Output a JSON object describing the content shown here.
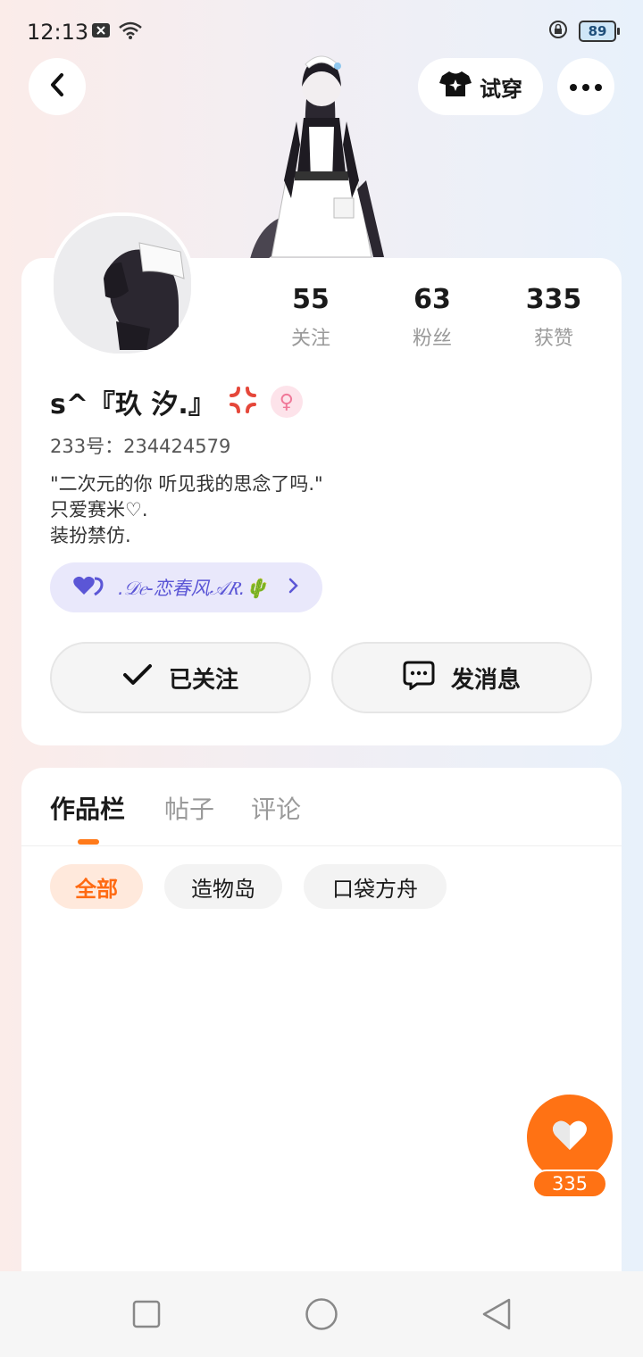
{
  "status_bar": {
    "time": "12:13",
    "battery": "89"
  },
  "header": {
    "tryon_label": "试穿"
  },
  "profile": {
    "stats": [
      {
        "value": "55",
        "label": "关注"
      },
      {
        "value": "63",
        "label": "粉丝"
      },
      {
        "value": "335",
        "label": "获赞"
      }
    ],
    "username": "s^『玖 汐.』",
    "user_id": "233号：234424579",
    "bio_lines": [
      "\"二次元的你 听见我的思念了吗.\"",
      "只爱赛米♡.",
      "装扮禁仿."
    ],
    "group_name": ".𝒟𝑒-恋春风𝒜𝑅.🌵",
    "follow_label": "已关注",
    "message_label": "发消息"
  },
  "tabs": [
    "作品栏",
    "帖子",
    "评论"
  ],
  "chips": [
    "全部",
    "造物岛",
    "口袋方舟"
  ],
  "like_count": "335",
  "colors": {
    "accent": "#ff7214",
    "group_text": "#5b56d6",
    "chip_active_bg": "#ffe9dc"
  }
}
